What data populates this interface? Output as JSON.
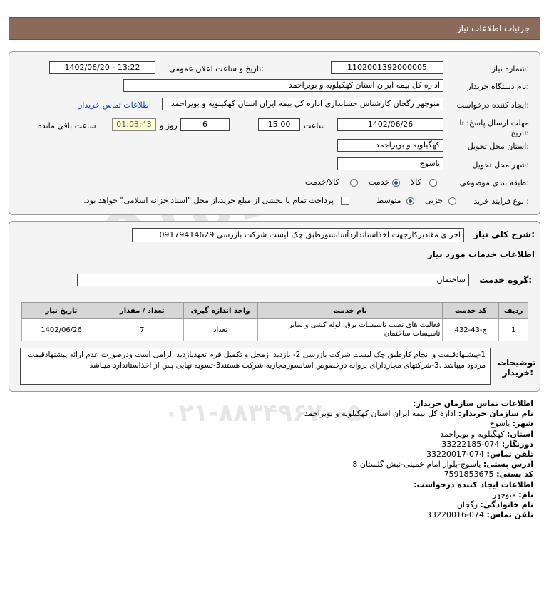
{
  "header": {
    "title": "جزئیات اطلاعات نیاز"
  },
  "form": {
    "need_number_label": "شماره نیاز:",
    "need_number": "1102001392000005",
    "announce_label": "تاریخ و ساعت اعلان عمومی:",
    "announce_value": "1402/06/20 - 13:22",
    "buyer_org_label": "نام دستگاه خریدار:",
    "buyer_org": "اداره کل بیمه ایران استان کهکیلویه و بویراحمد",
    "creator_label": "ایجاد کننده درخواست:",
    "creator": "منوچهر رگجان کارشناس حسابداری اداره کل بیمه ایران استان کهکیلویه و بویراحمد",
    "contact_link": "اطلاعات تماس خریدار",
    "deadline_label_1": "مهلت ارسال پاسخ: تا",
    "deadline_label_2": "تاریخ:",
    "deadline_date": "1402/06/26",
    "time_label": "ساعت",
    "deadline_time": "15:00",
    "days_value": "6",
    "days_label": "روز و",
    "remaining_time": "01:03:43",
    "remaining_label": "ساعت باقی مانده",
    "province_label": "استان محل تحویل:",
    "province": "کهگیلویه و بویراحمد",
    "city_label": "شهر محل تحویل:",
    "city": "یاسوج",
    "category_label": "طبقه بندی موضوعی:",
    "category_options": [
      "کالا",
      "خدمت",
      "کالا/خدمت"
    ],
    "category_selected": "خدمت",
    "process_label": "نوع فرآیند خرید :",
    "process_options": [
      "جزیی",
      "متوسط"
    ],
    "process_selected": "متوسط",
    "payment_note": "پرداخت تمام یا بخشی از مبلغ خرید،از محل \"اسناد خزانه اسلامی\" خواهد بود."
  },
  "need": {
    "desc_label": "شرح کلی نیاز:",
    "desc": "اجرای مقادیرکارجهت اخذاستانداردآسانسورطبق چک لیست شرکت بازرسی 09179414629",
    "services_heading": "اطلاعات خدمات مورد نیاز",
    "group_label": "گروه خدمت:",
    "group": "ساختمان"
  },
  "table": {
    "headers": [
      "ردیف",
      "کد خدمت",
      "نام خدمت",
      "واحد اندازه گیری",
      "تعداد / مقدار",
      "تاریخ نیاز"
    ],
    "rows": [
      {
        "row": "1",
        "code": "ج-43-432",
        "name": "فعالیت های نصب تاسیسات برق، لوله کشی و سایر تاسیسات ساختمان",
        "unit": "تعداد",
        "qty": "7",
        "date": "1402/06/26"
      }
    ]
  },
  "notes": {
    "label": "توضیحات خریدار:",
    "text": "1-پیشنهادقیمت و انجام کارطبق چک لیست شرکت بازرسی 2- بازدید ازمحل و تکمیل فرم تعهدبازدید الزامی است ودرصورت عدم ارائه پیشنهادقیمت مردود میباشد .3-شرکتهای مجازدارای پروانه درخصوص اسانسورمجازبه شرکت هستند3-تسویه نهایی پس از اخذاستاندارد میباشد"
  },
  "contact": {
    "heading": "اطلاعات تماس سازمان خریدار:",
    "org_label": "نام سازمان خریدار:",
    "org": "اداره کل بیمه ایران استان کهکیلویه و بویراحمد",
    "city_label": "شهر:",
    "city": "یاسوج",
    "province_label": "استان:",
    "province": "کهگیلویه و بویراحمد",
    "fax_label": "دورنگار:",
    "fax": "074-33222185",
    "phone_label": "تلفن تماس:",
    "phone": "074-33220017",
    "address_label": "آدرس پستی:",
    "address": "یاسوج-بلوار امام خمینی-نبش گلستان 8",
    "postal_label": "کد پستی:",
    "postal": "7591853675",
    "creator_heading": "اطلاعات ایجاد کننده درخواست:",
    "name_label": "نام:",
    "name": "منوچهر",
    "family_label": "نام خانوادگی:",
    "family": "رگجان",
    "creator_phone_label": "تلفن تماس:",
    "creator_phone": "074-33220016"
  }
}
